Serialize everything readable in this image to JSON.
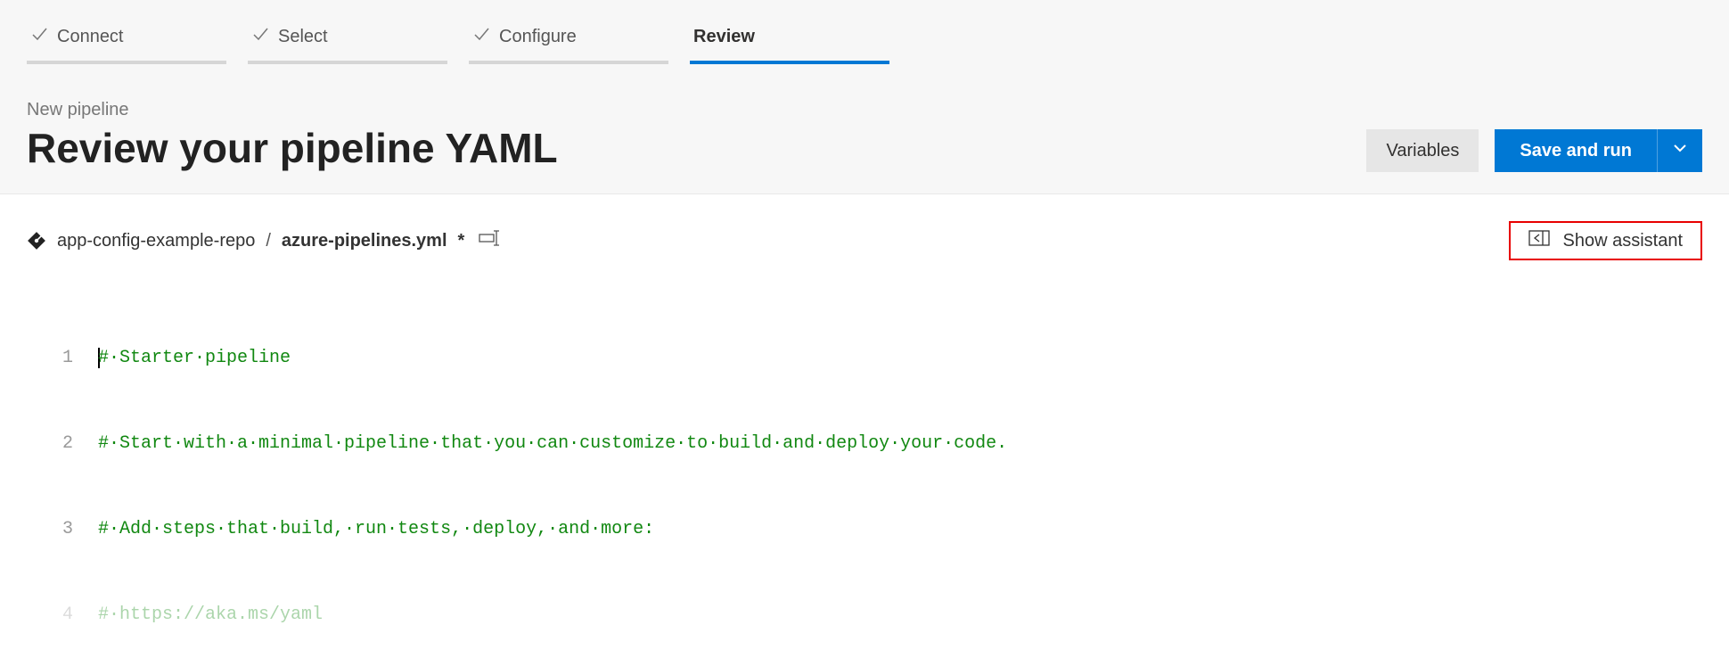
{
  "steps": {
    "connect": "Connect",
    "select": "Select",
    "configure": "Configure",
    "review": "Review"
  },
  "header": {
    "subtitle": "New pipeline",
    "title": "Review your pipeline YAML",
    "variables_label": "Variables",
    "save_run_label": "Save and run"
  },
  "filebar": {
    "repo": "app-config-example-repo",
    "slash": "/",
    "file": "azure-pipelines.yml",
    "dirty": "*",
    "assistant_label": "Show assistant"
  },
  "editor": {
    "lines": [
      {
        "n": "1",
        "text": "# Starter pipeline"
      },
      {
        "n": "2",
        "text": "# Start with a minimal pipeline that you can customize to build and deploy your code."
      },
      {
        "n": "3",
        "text": "# Add steps that build, run tests, deploy, and more:"
      },
      {
        "n": "4",
        "text": "# https://aka.ms/yaml"
      }
    ]
  }
}
